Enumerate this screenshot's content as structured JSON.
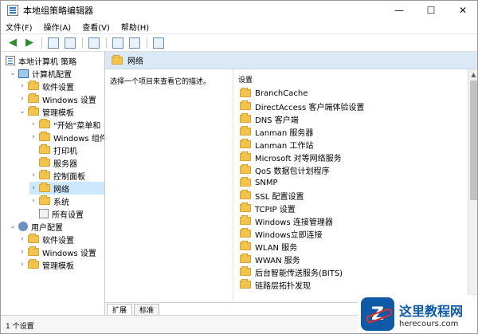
{
  "window": {
    "title": "本地组策略编辑器",
    "controls": [
      "—",
      "☐",
      "✕"
    ]
  },
  "menu": [
    "文件(F)",
    "操作(A)",
    "查看(V)",
    "帮助(H)"
  ],
  "toolbar": {
    "icons": [
      "back-icon",
      "forward-icon",
      "folder-up-icon",
      "tree-view-icon",
      "export-icon",
      "help-icon",
      "properties-icon",
      "filter-icon"
    ]
  },
  "tree": {
    "root": "本地计算机 策略",
    "nodes": [
      {
        "label": "计算机配置",
        "level": 1,
        "expander": "⌄",
        "icon": "computer"
      },
      {
        "label": "软件设置",
        "level": 2,
        "expander": "›",
        "icon": "folder"
      },
      {
        "label": "Windows 设置",
        "level": 2,
        "expander": "›",
        "icon": "folder"
      },
      {
        "label": "管理模板",
        "level": 2,
        "expander": "⌄",
        "icon": "folder"
      },
      {
        "label": "\"开始\"菜单和",
        "level": 3,
        "expander": "›",
        "icon": "folder"
      },
      {
        "label": "Windows 组件",
        "level": 3,
        "expander": "›",
        "icon": "folder"
      },
      {
        "label": "打印机",
        "level": 3,
        "expander": "",
        "icon": "folder"
      },
      {
        "label": "服务器",
        "level": 3,
        "expander": "",
        "icon": "folder"
      },
      {
        "label": "控制面板",
        "level": 3,
        "expander": "›",
        "icon": "folder"
      },
      {
        "label": "网络",
        "level": 3,
        "expander": "›",
        "icon": "folder",
        "selected": true
      },
      {
        "label": "系统",
        "level": 3,
        "expander": "›",
        "icon": "folder"
      },
      {
        "label": "所有设置",
        "level": 3,
        "expander": "",
        "icon": "settings"
      },
      {
        "label": "用户配置",
        "level": 1,
        "expander": "⌄",
        "icon": "user"
      },
      {
        "label": "软件设置",
        "level": 2,
        "expander": "›",
        "icon": "folder"
      },
      {
        "label": "Windows 设置",
        "level": 2,
        "expander": "›",
        "icon": "folder"
      },
      {
        "label": "管理模板",
        "level": 2,
        "expander": "›",
        "icon": "folder"
      }
    ]
  },
  "right": {
    "header": "网络",
    "description": "选择一个项目来查看它的描述。",
    "list_header": "设置",
    "items": [
      "BranchCache",
      "DirectAccess 客户端体验设置",
      "DNS 客户端",
      "Lanman 服务器",
      "Lanman 工作站",
      "Microsoft 对等网络服务",
      "QoS 数据包计划程序",
      "SNMP",
      "SSL 配置设置",
      "TCPIP 设置",
      "Windows 连接管理器",
      "Windows立即连接",
      "WLAN 服务",
      "WWAN 服务",
      "后台智能传送服务(BITS)",
      "链路层拓扑发现"
    ],
    "tabs": [
      "扩展",
      "标准"
    ]
  },
  "status": "1 个设置",
  "watermark": {
    "badge": "Z",
    "cn": "这里教程网",
    "en": "herecours.com"
  }
}
